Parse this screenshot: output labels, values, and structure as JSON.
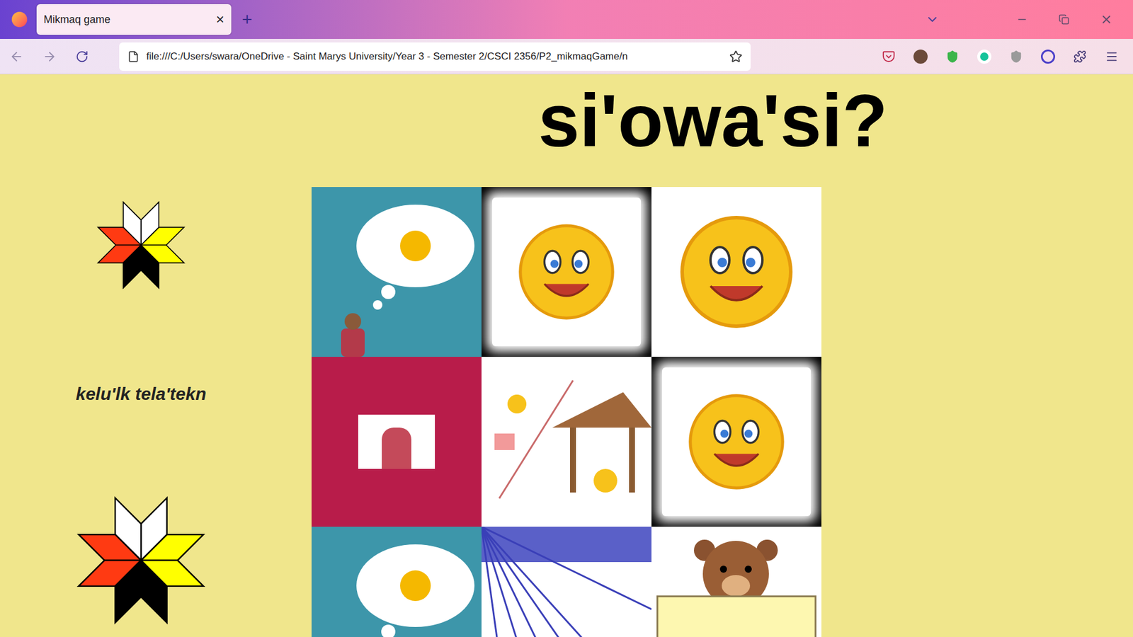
{
  "browser": {
    "tabs": [
      {
        "label": "Mikmaq game",
        "selected": true,
        "close": "×"
      }
    ],
    "new_tab": "+",
    "url": "file:///C:/Users/swara/OneDrive - Saint Marys University/Year 3 - Semester 2/CSCI 2356/P2_mikmaqGame/n",
    "extensions": [
      {
        "kind": "pocket",
        "color": "#c22a4a"
      },
      {
        "kind": "avatar",
        "color": "#6b4a3a"
      },
      {
        "kind": "shield",
        "color": "#3bb54a"
      },
      {
        "kind": "grammarly",
        "color": "#15c39a"
      },
      {
        "kind": "shield",
        "color": "#9a9a9a"
      },
      {
        "kind": "ring",
        "color": "#4b3fc9"
      },
      {
        "kind": "puzzle",
        "color": "#4b3f7a"
      },
      {
        "kind": "menu",
        "color": "#4b3f7a"
      }
    ]
  },
  "page": {
    "title": "si'owa'si?",
    "caption": "kelu'lk tela'tekn",
    "cells": [
      {
        "kind": "thought",
        "color": "#3d96aa"
      },
      {
        "kind": "emoji-framed",
        "color": "#ffffff"
      },
      {
        "kind": "emoji",
        "color": "#ffffff"
      },
      {
        "kind": "photo",
        "color": "#b81c4a"
      },
      {
        "kind": "drawing",
        "color": "#ffffff"
      },
      {
        "kind": "emoji-framed",
        "color": "#ffffff"
      },
      {
        "kind": "thought",
        "color": "#3d96aa"
      },
      {
        "kind": "lines",
        "color": "#ffffff"
      },
      {
        "kind": "bear",
        "color": "#ffffff"
      }
    ]
  }
}
